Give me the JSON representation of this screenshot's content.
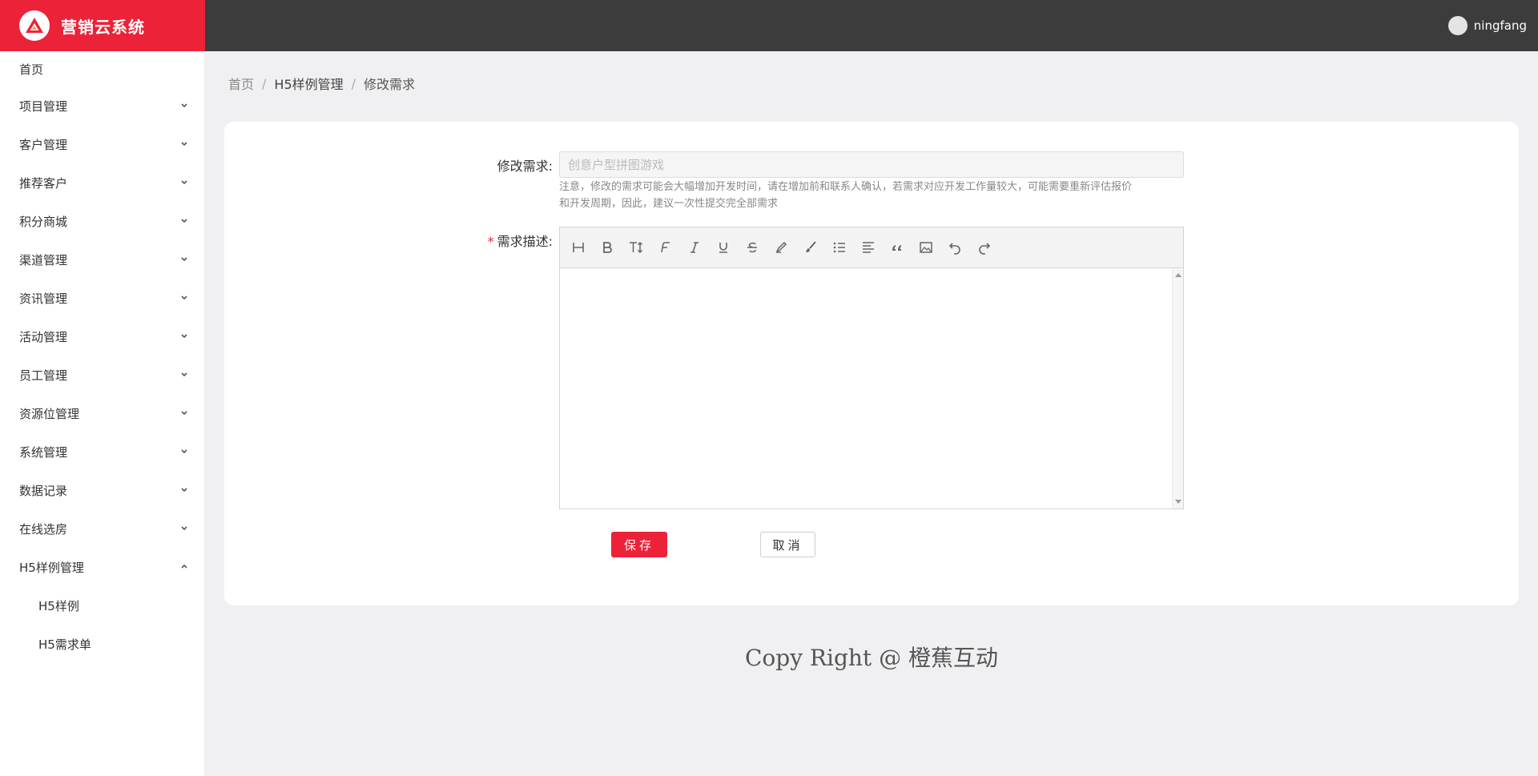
{
  "app": {
    "name": "营销云系统"
  },
  "user": {
    "name": "ningfang"
  },
  "sidebar": {
    "home": "首页",
    "groups": [
      {
        "label": "项目管理",
        "expanded": false
      },
      {
        "label": "客户管理",
        "expanded": false
      },
      {
        "label": "推荐客户",
        "expanded": false
      },
      {
        "label": "积分商城",
        "expanded": false
      },
      {
        "label": "渠道管理",
        "expanded": false
      },
      {
        "label": "资讯管理",
        "expanded": false
      },
      {
        "label": "活动管理",
        "expanded": false
      },
      {
        "label": "员工管理",
        "expanded": false
      },
      {
        "label": "资源位管理",
        "expanded": false
      },
      {
        "label": "系统管理",
        "expanded": false
      },
      {
        "label": "数据记录",
        "expanded": false
      },
      {
        "label": "在线选房",
        "expanded": false
      },
      {
        "label": "H5样例管理",
        "expanded": true
      }
    ],
    "sub_items": [
      "H5样例",
      "H5需求单"
    ]
  },
  "breadcrumb": {
    "items": [
      "首页",
      "H5样例管理",
      "修改需求"
    ],
    "separator": "/"
  },
  "form": {
    "title_label": "修改需求:",
    "title_placeholder": "创意户型拼图游戏",
    "title_value": "",
    "hint_line1": "注意，修改的需求可能会大幅增加开发时间，请在增加前和联系人确认，若需求对应开发工作量较大，可能需要重新评估报价",
    "hint_line2": "和开发周期，因此，建议一次性提交完全部需求",
    "desc_required_mark": "*",
    "desc_label": "需求描述:",
    "toolbar_icons": [
      "heading-icon",
      "bold-icon",
      "font-size-icon",
      "font-family-icon",
      "italic-icon",
      "underline-icon",
      "strikethrough-icon",
      "font-color-icon",
      "background-color-icon",
      "list-icon",
      "align-icon",
      "quote-icon",
      "image-icon",
      "undo-icon",
      "redo-icon"
    ]
  },
  "buttons": {
    "save": "保存",
    "cancel": "取消"
  },
  "footer": {
    "text": "Copy Right @ 橙蕉互动"
  },
  "colors": {
    "accent": "#ec2238",
    "header": "#3c3c3c",
    "background": "#f0f0f2"
  }
}
